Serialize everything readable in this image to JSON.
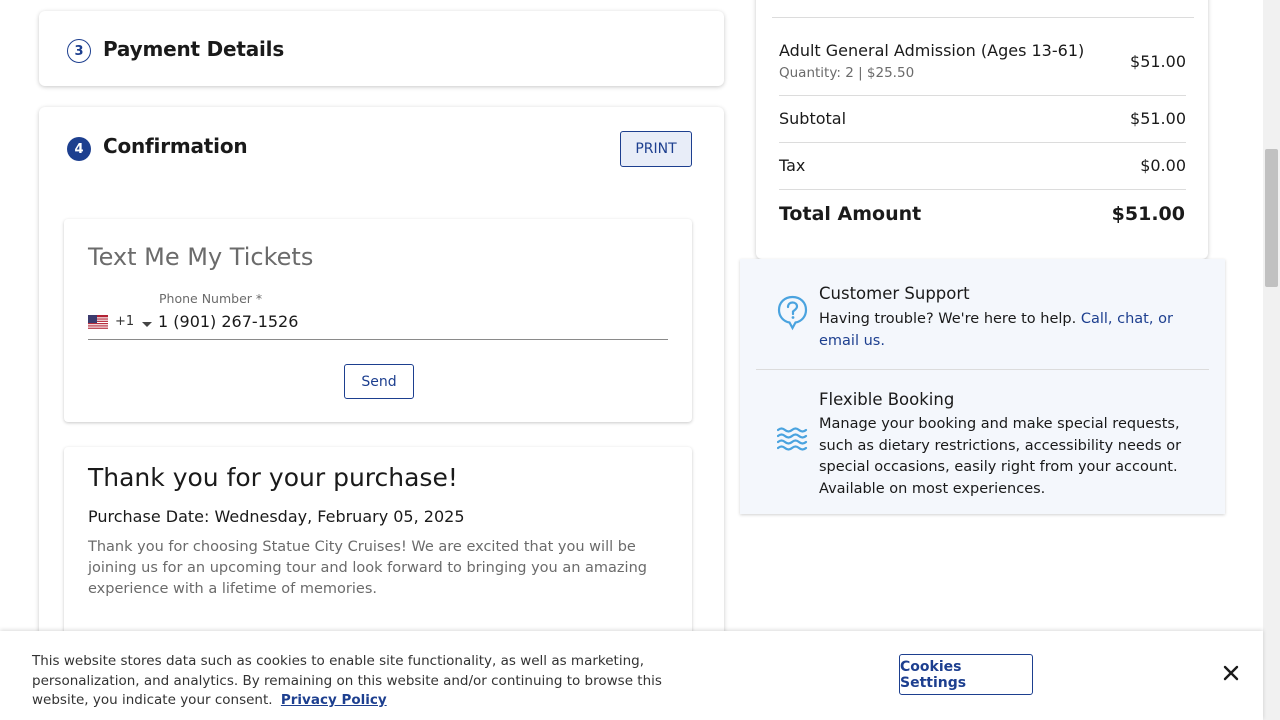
{
  "steps": {
    "payment": {
      "number": "3",
      "title": "Payment Details"
    },
    "confirmation": {
      "number": "4",
      "title": "Confirmation",
      "print_label": "PRINT"
    }
  },
  "text_tickets": {
    "heading": "Text Me My Tickets",
    "phone_label": "Phone Number *",
    "dial_code": "+1",
    "phone_value": "1 (901) 267-1526",
    "send_label": "Send"
  },
  "thank_you": {
    "title": "Thank you for your purchase!",
    "purchase_date": "Purchase Date: Wednesday, February 05, 2025",
    "body": "Thank you for choosing Statue City Cruises! We are excited that you will be joining us for an upcoming tour and look forward to bringing you an amazing experience with a lifetime of memories."
  },
  "summary": {
    "item_name": "Adult General Admission (Ages 13-61)",
    "item_detail": "Quantity: 2 | $25.50",
    "item_price": "$51.00",
    "subtotal_label": "Subtotal",
    "subtotal_value": "$51.00",
    "tax_label": "Tax",
    "tax_value": "$0.00",
    "total_label": "Total Amount",
    "total_value": "$51.00"
  },
  "support": {
    "title": "Customer Support",
    "text": "Having trouble? We're here to help.",
    "link": "Call, chat, or email us."
  },
  "flexible": {
    "title": "Flexible Booking",
    "text": "Manage your booking and make special requests, such as dietary restrictions, accessibility needs or special occasions, easily right from your account. Available on most experiences."
  },
  "cookie_banner": {
    "text": "This website stores data such as cookies to enable site functionality, as well as marketing, personalization, and analytics. By remaining on this website and/or continuing to browse this website, you indicate your consent.",
    "privacy_link": "Privacy Policy",
    "settings_label": "Cookies Settings"
  },
  "colors": {
    "brand_blue": "#1d3f8f",
    "icon_blue": "#4aa3df",
    "panel_bg": "#f4f7fc"
  },
  "icons": {
    "support": "question-bubble-icon",
    "flexible": "waves-icon",
    "close": "close-icon",
    "flag": "us-flag-icon",
    "caret": "caret-down-icon"
  }
}
